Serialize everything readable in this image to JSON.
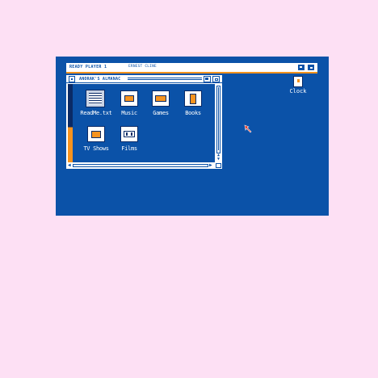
{
  "titlebar": {
    "app_title": "READY PLAYER 1",
    "author": "ERNEST CLINE"
  },
  "window": {
    "title": "ANORAK'S ALMANAC",
    "scroll_up_arrow": "▲",
    "scroll_down_arrow": "▼",
    "scroll_left_arrow": "◀",
    "scroll_right_arrow": "▶",
    "icons": [
      {
        "label": "ReadMe.txt",
        "icon": "text-document-icon"
      },
      {
        "label": "Music",
        "icon": "cassette-icon"
      },
      {
        "label": "Games",
        "icon": "game-cartridge-icon"
      },
      {
        "label": "Books",
        "icon": "book-icon"
      },
      {
        "label": "TV Shows",
        "icon": "tv-icon"
      },
      {
        "label": "Films",
        "icon": "film-icon"
      }
    ]
  },
  "desktop": {
    "clock_label": "Clock"
  },
  "colors": {
    "background": "#fde0f4",
    "screen_blue": "#0b52a8",
    "accent_orange": "#f7931e",
    "white": "#ffffff",
    "dark_blue": "#0a2a66"
  }
}
